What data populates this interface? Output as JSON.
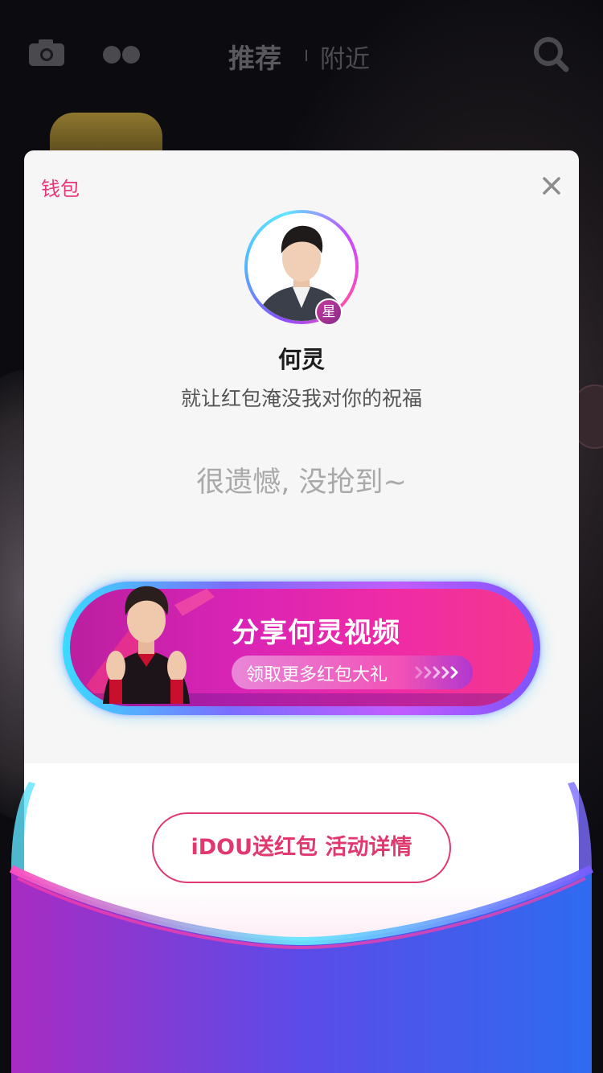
{
  "topbar": {
    "camera_icon": "camera-icon",
    "dots_icon": "dots-icon",
    "tab_recommend": "推荐",
    "tab_nearby": "附近",
    "search_icon": "search-icon"
  },
  "modal": {
    "wallet_label": "钱包",
    "close_icon": "close-icon",
    "star_badge": "星",
    "name": "何灵",
    "blessing": "就让红包淹没我对你的祝福",
    "result": "很遗憾, 没抢到~",
    "share": {
      "title": "分享何灵视频",
      "subtitle": "领取更多红包大礼"
    },
    "details_button": "iDOU送红包 活动详情"
  },
  "colors": {
    "accent": "#e8357a",
    "banner_pink": "#ef2ba6",
    "banner_glow": "#39dcff"
  }
}
